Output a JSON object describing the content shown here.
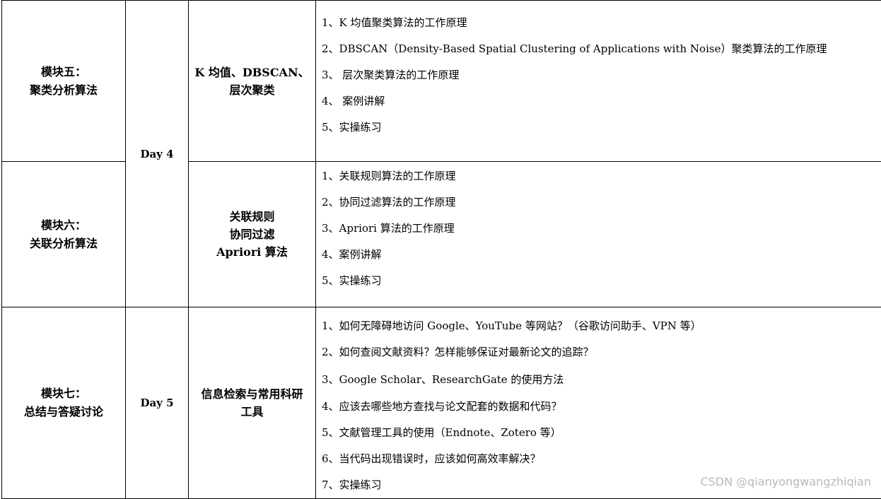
{
  "rows": [
    {
      "module": [
        "模块五：",
        "聚类分析算法"
      ],
      "day": "Day 4",
      "topic": [
        "K 均值、DBSCAN、",
        "层次聚类"
      ],
      "items": [
        "1、K 均值聚类算法的工作原理",
        "2、DBSCAN（Density-Based Spatial Clustering of Applications with Noise）聚类算法的工作原理",
        "3、 层次聚类算法的工作原理",
        "4、 案例讲解",
        "5、实操练习"
      ]
    },
    {
      "module": [
        "模块六：",
        "关联分析算法"
      ],
      "topic": [
        "关联规则",
        "协同过滤",
        "Apriori 算法"
      ],
      "items": [
        "1、关联规则算法的工作原理",
        "2、协同过滤算法的工作原理",
        "3、Apriori 算法的工作原理",
        "4、案例讲解",
        "5、实操练习"
      ]
    },
    {
      "module": [
        "模块七：",
        "总结与答疑讨论"
      ],
      "day": "Day 5",
      "topic": [
        "信息检索与常用科研",
        "工具"
      ],
      "items": [
        "1、如何无障碍地访问 Google、YouTube 等网站？（谷歌访问助手、VPN 等）",
        "2、如何查阅文献资料？怎样能够保证对最新论文的追踪？",
        "3、Google Scholar、ResearchGate 的使用方法",
        "4、应该去哪些地方查找与论文配套的数据和代码？",
        "5、文献管理工具的使用（Endnote、Zotero 等）",
        "6、当代码出现错误时，应该如何高效率解决？",
        "7、实操练习"
      ]
    }
  ],
  "watermark": "CSDN @qianyongwangzhiqian"
}
